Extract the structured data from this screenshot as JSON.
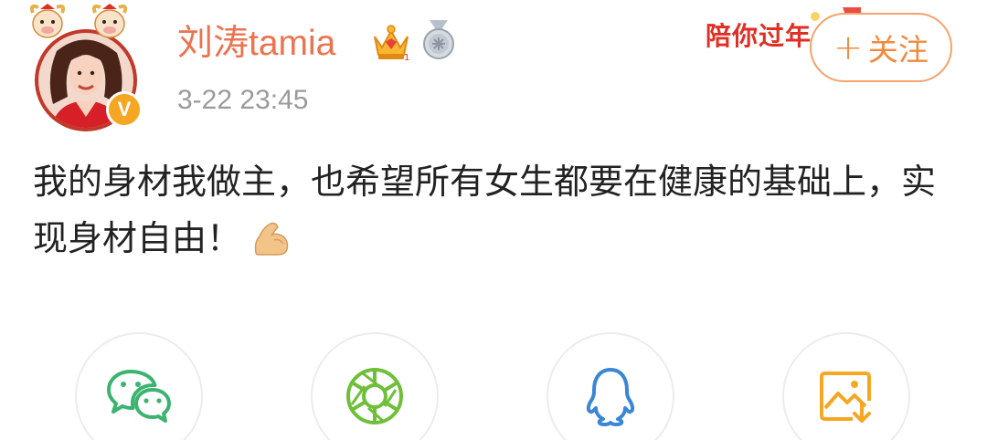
{
  "header": {
    "user_name": "刘涛tamia",
    "post_time": "3-22 23:45",
    "promo_banner": "陪你过年",
    "follow_label": "关注",
    "follow_plus": "+"
  },
  "post": {
    "text": "我的身材我做主，也希望所有女生都要在健康的基础上，实现身材自由！"
  },
  "share": {
    "items": [
      {
        "icon": "wechat-icon"
      },
      {
        "icon": "moments-icon"
      },
      {
        "icon": "qq-icon"
      },
      {
        "icon": "save-image-icon"
      }
    ]
  },
  "colors": {
    "username": "#eb7350",
    "follow": "#f08a3c",
    "timestamp": "#9a9a9a",
    "text": "#222222",
    "wechat": "#3cb371",
    "moments": "#6fbf3a",
    "qq": "#3a86d6",
    "save": "#f5a623"
  }
}
